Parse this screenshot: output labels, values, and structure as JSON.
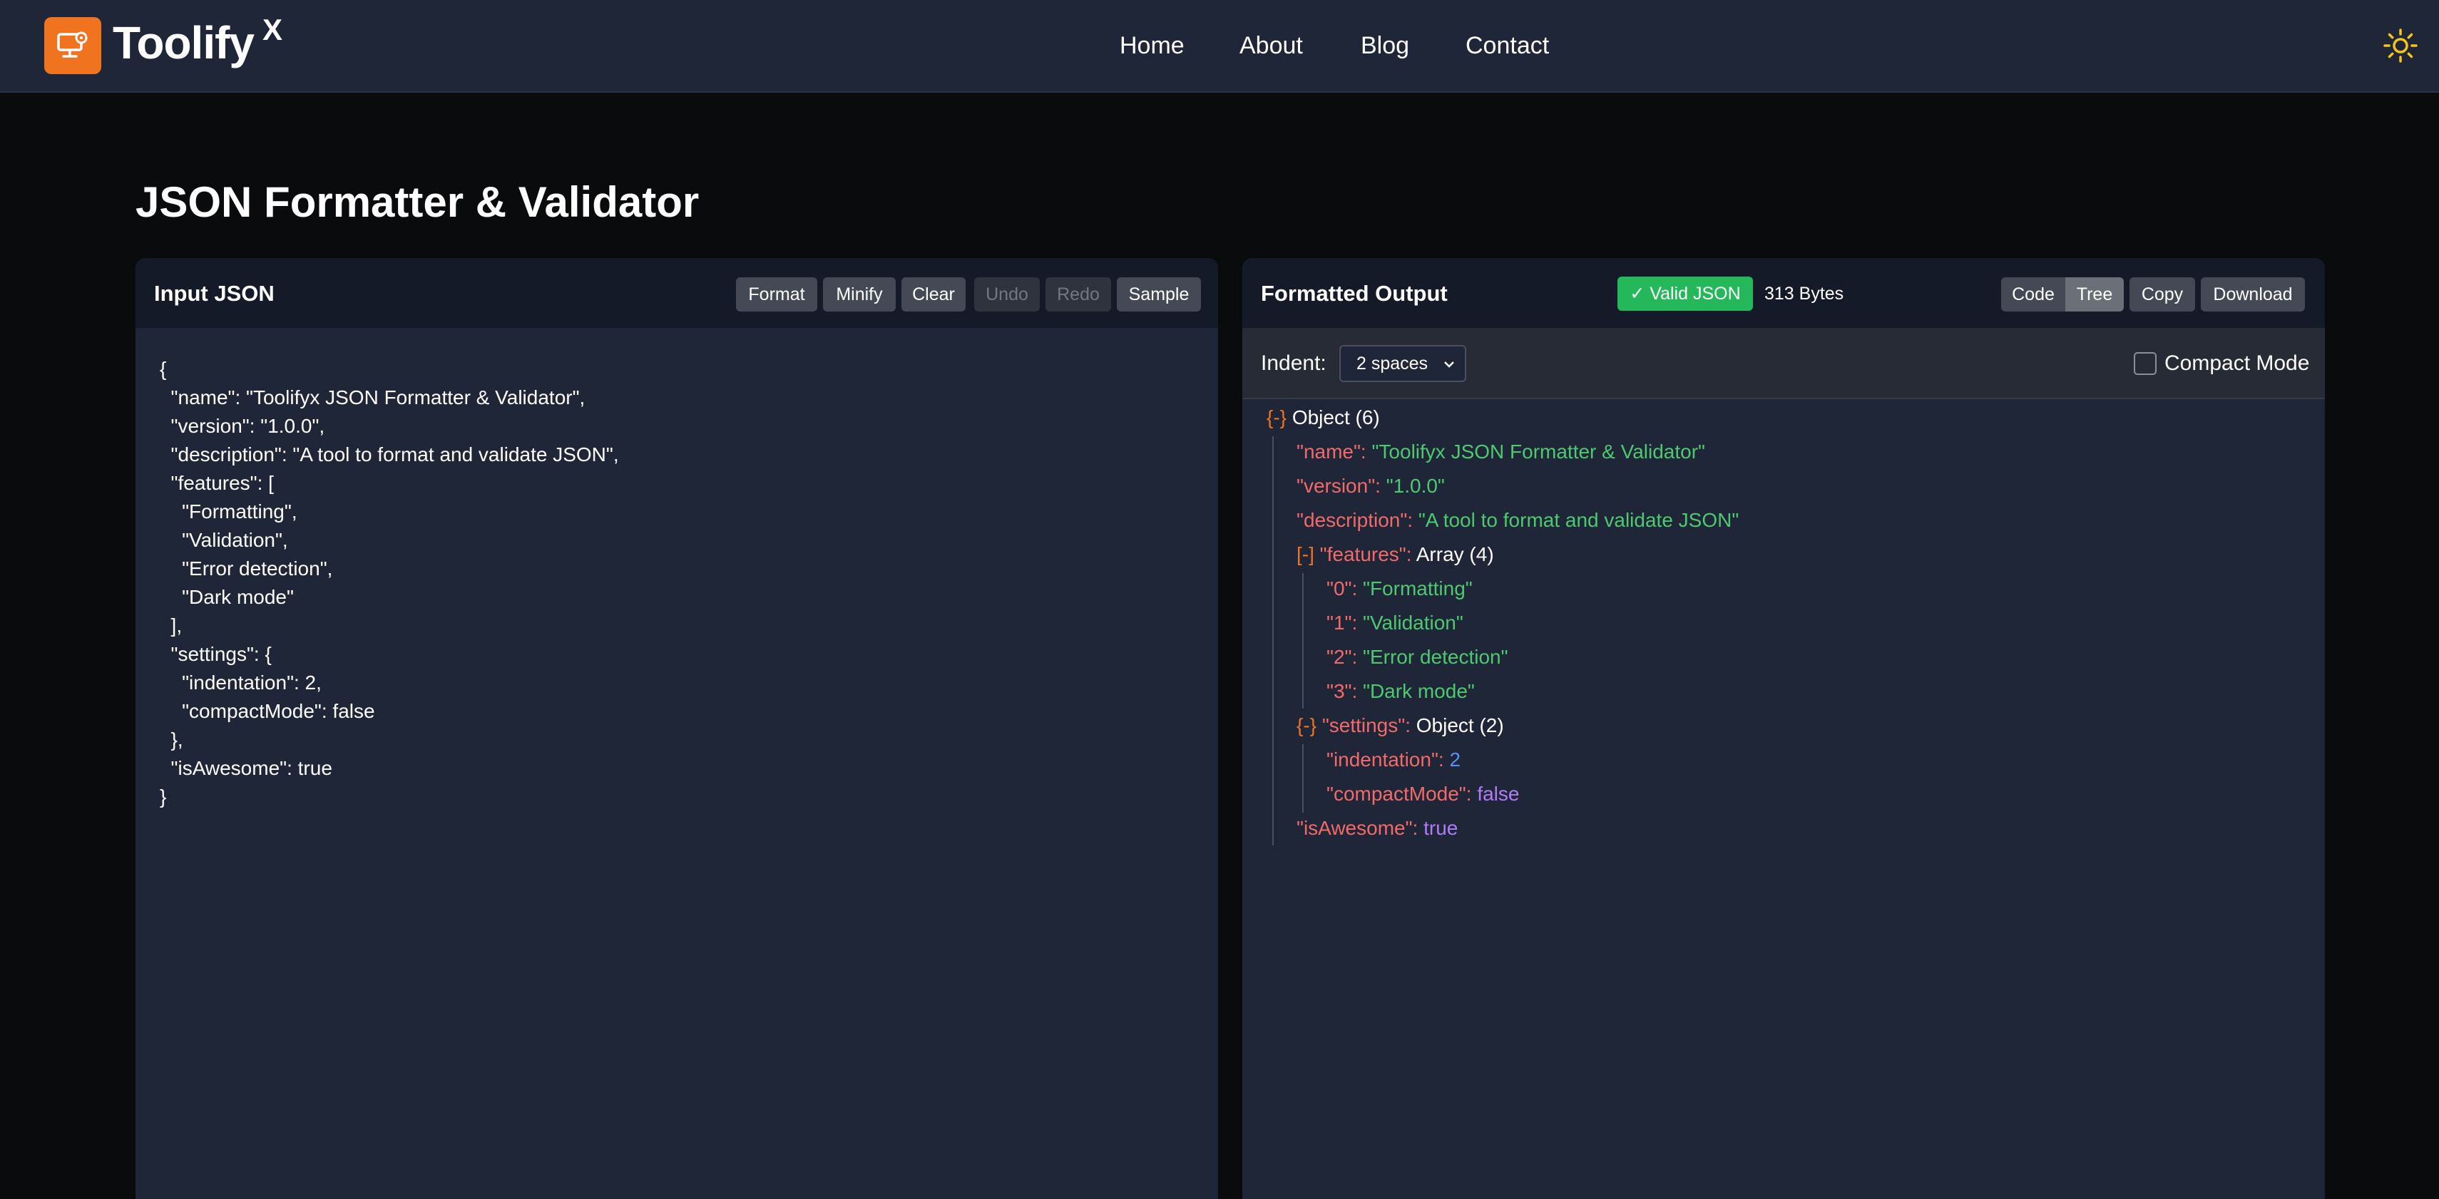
{
  "header": {
    "brand_name": "Toolify",
    "brand_sup": "X",
    "nav": [
      "Home",
      "About",
      "Blog",
      "Contact"
    ]
  },
  "page": {
    "title": "JSON Formatter & Validator"
  },
  "input_panel": {
    "heading": "Input JSON",
    "buttons": {
      "format": "Format",
      "minify": "Minify",
      "clear": "Clear",
      "undo": "Undo",
      "redo": "Redo",
      "sample": "Sample"
    },
    "content": "{\n  \"name\": \"Toolifyx JSON Formatter & Validator\",\n  \"version\": \"1.0.0\",\n  \"description\": \"A tool to format and validate JSON\",\n  \"features\": [\n    \"Formatting\",\n    \"Validation\",\n    \"Error detection\",\n    \"Dark mode\"\n  ],\n  \"settings\": {\n    \"indentation\": 2,\n    \"compactMode\": false\n  },\n  \"isAwesome\": true\n}"
  },
  "output_panel": {
    "heading": "Formatted Output",
    "status_badge": "✓ Valid JSON",
    "size_text": "313 Bytes",
    "view_buttons": {
      "code": "Code",
      "tree": "Tree",
      "copy": "Copy",
      "download": "Download"
    },
    "active_view": "Tree",
    "indent_label": "Indent:",
    "indent_value": "2 spaces",
    "compact_label": "Compact Mode",
    "compact_checked": false,
    "tree": [
      {
        "toggle": "{-}",
        "key": "",
        "sep": "",
        "value": "Object (6)",
        "kind": "type"
      },
      {
        "toggle": "",
        "key": "\"name\"",
        "sep": ": ",
        "value": "\"Toolifyx JSON Formatter & Validator\"",
        "kind": "str"
      },
      {
        "toggle": "",
        "key": "\"version\"",
        "sep": ": ",
        "value": "\"1.0.0\"",
        "kind": "str"
      },
      {
        "toggle": "",
        "key": "\"description\"",
        "sep": ": ",
        "value": "\"A tool to format and validate JSON\"",
        "kind": "str"
      },
      {
        "toggle": "[-]",
        "key": "\"features\"",
        "sep": ": ",
        "value": "Array (4)",
        "kind": "type"
      },
      {
        "toggle": "",
        "key": "\"0\"",
        "sep": ": ",
        "value": "\"Formatting\"",
        "kind": "str"
      },
      {
        "toggle": "",
        "key": "\"1\"",
        "sep": ": ",
        "value": "\"Validation\"",
        "kind": "str"
      },
      {
        "toggle": "",
        "key": "\"2\"",
        "sep": ": ",
        "value": "\"Error detection\"",
        "kind": "str"
      },
      {
        "toggle": "",
        "key": "\"3\"",
        "sep": ": ",
        "value": "\"Dark mode\"",
        "kind": "str"
      },
      {
        "toggle": "{-}",
        "key": "\"settings\"",
        "sep": ": ",
        "value": "Object (2)",
        "kind": "type"
      },
      {
        "toggle": "",
        "key": "\"indentation\"",
        "sep": ": ",
        "value": "2",
        "kind": "num"
      },
      {
        "toggle": "",
        "key": "\"compactMode\"",
        "sep": ": ",
        "value": "false",
        "kind": "bool"
      },
      {
        "toggle": "",
        "key": "\"isAwesome\"",
        "sep": ": ",
        "value": "true",
        "kind": "bool"
      }
    ]
  },
  "colors": {
    "accent": "#f0731f",
    "valid": "#25b85a",
    "key": "#f26a6a",
    "string": "#4ec96f",
    "number": "#5a8ff5",
    "boolean": "#b07cf5"
  }
}
